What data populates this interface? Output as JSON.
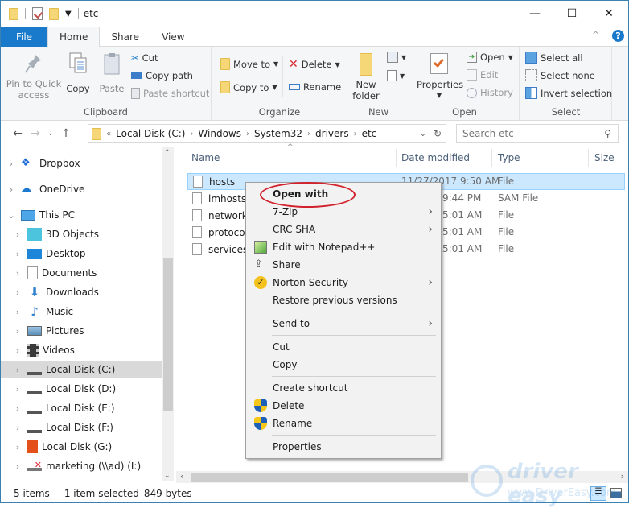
{
  "window": {
    "title": "etc",
    "controls": {
      "minimize": "—",
      "maximize": "☐",
      "close": "✕"
    }
  },
  "ribbon_tabs": [
    {
      "label": "File"
    },
    {
      "label": "Home"
    },
    {
      "label": "Share"
    },
    {
      "label": "View"
    }
  ],
  "ribbon": {
    "clipboard": {
      "label": "Clipboard",
      "pin": "Pin to Quick access",
      "pin_line1": "Pin to Quick",
      "pin_line2": "access",
      "copy": "Copy",
      "paste": "Paste",
      "cut": "Cut",
      "copy_path": "Copy path",
      "paste_shortcut": "Paste shortcut"
    },
    "organize": {
      "label": "Organize",
      "move_to": "Move to",
      "copy_to": "Copy to",
      "delete": "Delete",
      "rename": "Rename"
    },
    "new": {
      "label": "New",
      "new_folder_line1": "New",
      "new_folder_line2": "folder"
    },
    "open": {
      "label": "Open",
      "properties": "Properties",
      "open": "Open",
      "edit": "Edit",
      "history": "History"
    },
    "select": {
      "label": "Select",
      "select_all": "Select all",
      "select_none": "Select none",
      "invert": "Invert selection"
    }
  },
  "address": {
    "overflow": "«",
    "crumbs": [
      "Local Disk (C:)",
      "Windows",
      "System32",
      "drivers",
      "etc"
    ],
    "search_placeholder": "Search etc"
  },
  "nav": [
    {
      "label": "Dropbox",
      "icon": "dropbox-icon",
      "expanded": false
    },
    {
      "label": "OneDrive",
      "icon": "onedrive-icon",
      "expanded": false
    },
    {
      "label": "This PC",
      "icon": "computer-icon",
      "expanded": true
    },
    {
      "label": "3D Objects",
      "icon": "3d-objects-icon"
    },
    {
      "label": "Desktop",
      "icon": "desktop-icon"
    },
    {
      "label": "Documents",
      "icon": "documents-icon"
    },
    {
      "label": "Downloads",
      "icon": "downloads-icon"
    },
    {
      "label": "Music",
      "icon": "music-icon"
    },
    {
      "label": "Pictures",
      "icon": "pictures-icon"
    },
    {
      "label": "Videos",
      "icon": "videos-icon"
    },
    {
      "label": "Local Disk (C:)",
      "icon": "drive-c-icon",
      "selected": true
    },
    {
      "label": "Local Disk (D:)",
      "icon": "drive-icon"
    },
    {
      "label": "Local Disk (E:)",
      "icon": "drive-icon"
    },
    {
      "label": "Local Disk (F:)",
      "icon": "drive-icon"
    },
    {
      "label": "Local Disk (G:)",
      "icon": "office-drive-icon"
    },
    {
      "label": "marketing (\\\\ad) (I:)",
      "icon": "network-drive-disconnected-icon"
    }
  ],
  "columns": {
    "name": "Name",
    "date": "Date modified",
    "type": "Type",
    "size": "Size"
  },
  "files": [
    {
      "name": "hosts",
      "date": "11/27/2017 9:50 AM",
      "type": "File",
      "selected": true
    },
    {
      "name": "lmhosts.sam",
      "name_visible": "lmhosts.",
      "date": "9:44 PM",
      "type": "SAM File"
    },
    {
      "name": "networks",
      "name_visible": "networks",
      "date": "5:01 AM",
      "type": "File"
    },
    {
      "name": "protocol",
      "name_visible": "protocol",
      "date": "5:01 AM",
      "type": "File"
    },
    {
      "name": "services",
      "date": "5:01 AM",
      "type": "File"
    }
  ],
  "context_menu": [
    {
      "label": "Open with",
      "bold": true
    },
    {
      "label": "7-Zip",
      "submenu": true
    },
    {
      "label": "CRC SHA",
      "submenu": true
    },
    {
      "label": "Edit with Notepad++",
      "icon": "notepad-plus-plus-icon"
    },
    {
      "label": "Share",
      "icon": "share-icon"
    },
    {
      "label": "Norton Security",
      "icon": "norton-icon",
      "submenu": true
    },
    {
      "label": "Restore previous versions"
    },
    {
      "label": "Send to",
      "submenu": true
    },
    {
      "label": "Cut"
    },
    {
      "label": "Copy"
    },
    {
      "label": "Create shortcut"
    },
    {
      "label": "Delete",
      "icon": "uac-shield-icon"
    },
    {
      "label": "Rename",
      "icon": "uac-shield-icon"
    },
    {
      "label": "Properties"
    }
  ],
  "status": {
    "count": "5 items",
    "selection": "1 item selected",
    "size": "849 bytes"
  },
  "watermark": {
    "line1": "driver easy",
    "line2": "www.DriverEasy.com"
  },
  "colors": {
    "accent": "#1979ca",
    "selection": "#cce8ff",
    "highlight_ellipse": "#d2222d"
  }
}
